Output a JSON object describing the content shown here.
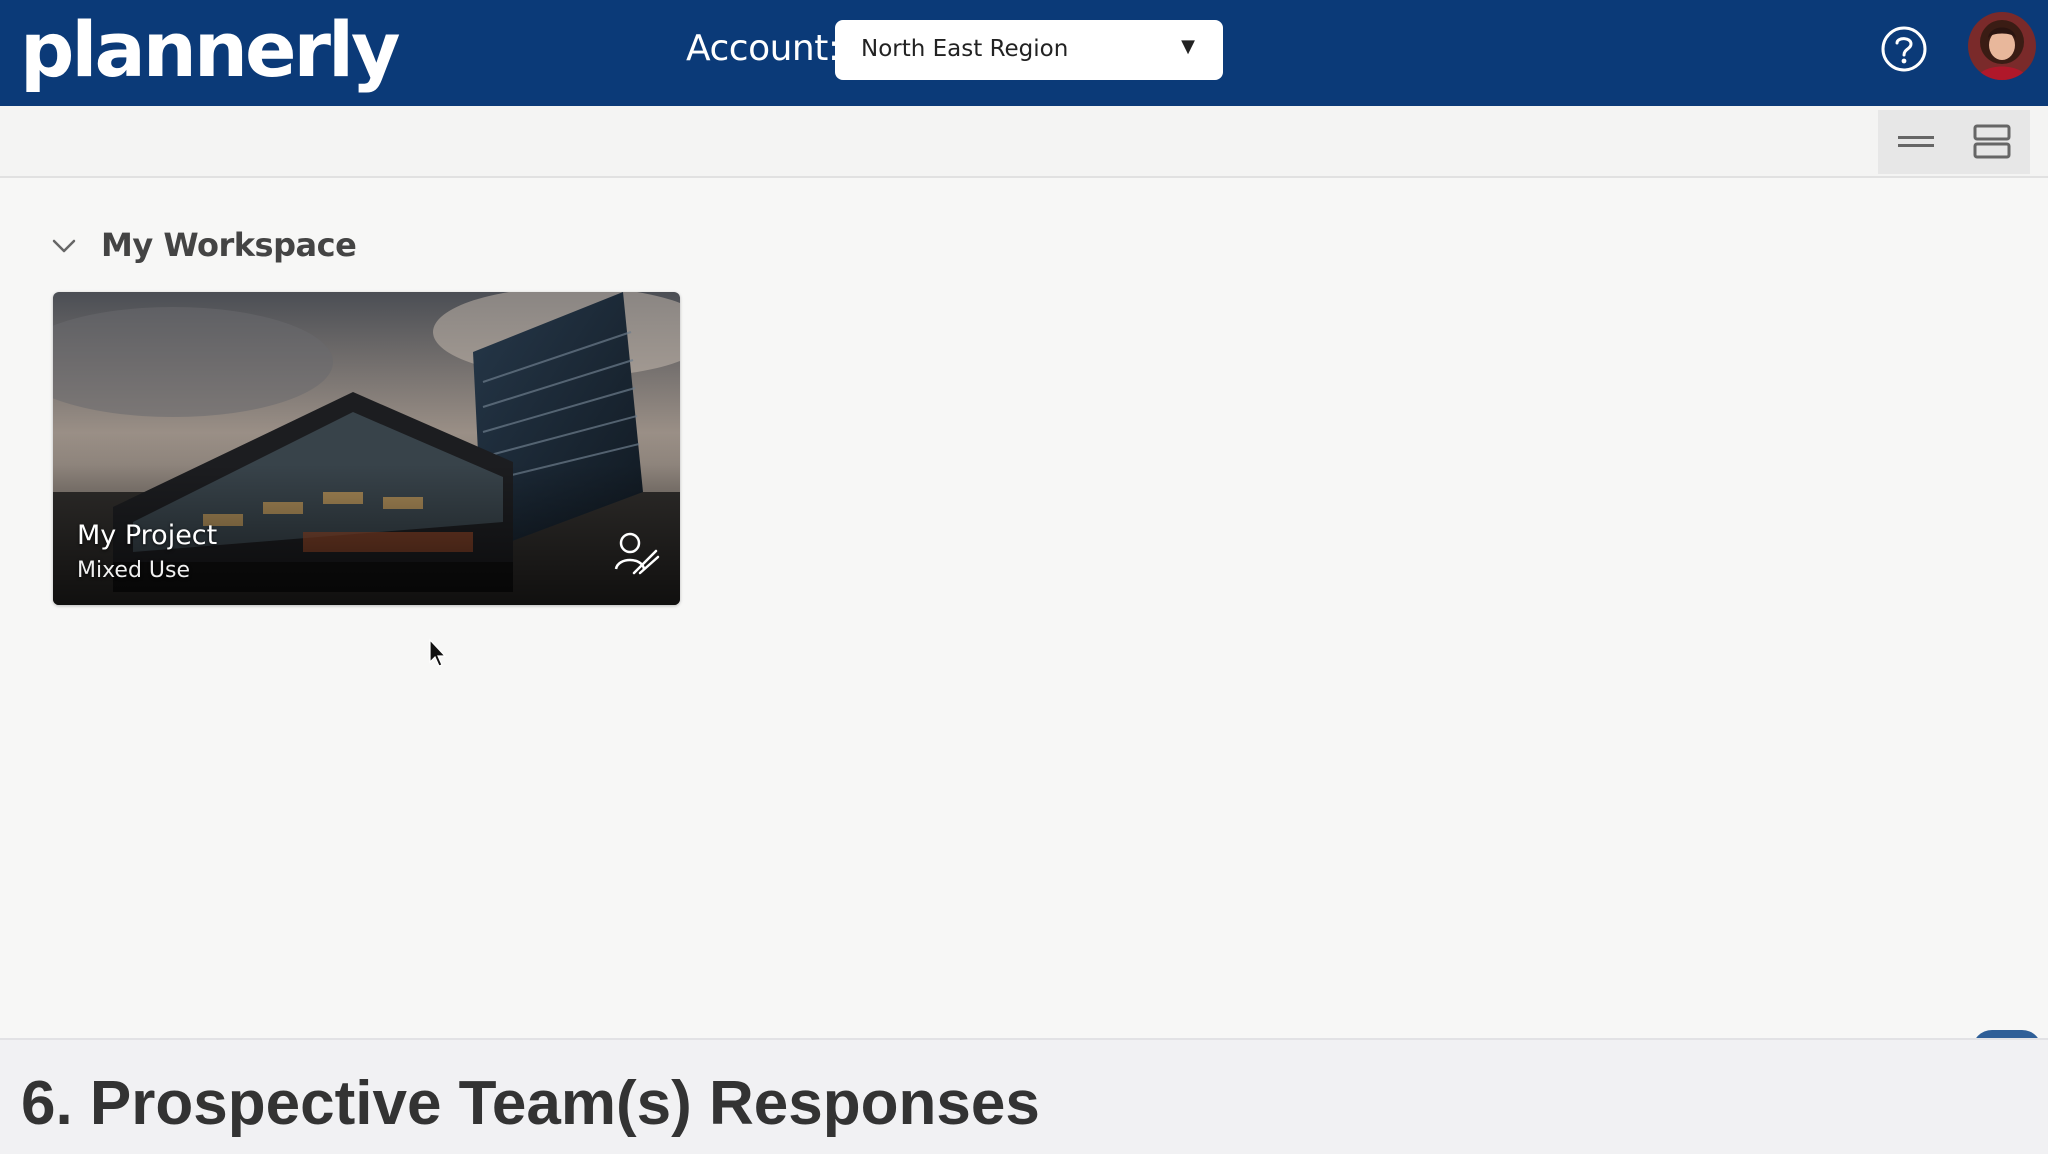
{
  "app": {
    "logo_text": "plannerly"
  },
  "header": {
    "account_label": "Account:",
    "account_value": "North East Region",
    "help_icon": "help-circle-icon",
    "avatar_icon": "user-avatar"
  },
  "toolbar": {
    "view_list_icon": "list-view-icon",
    "view_rows_icon": "rows-view-icon"
  },
  "workspace": {
    "title": "My Workspace",
    "projects": [
      {
        "title": "My Project",
        "subtitle": "Mixed Use",
        "icon": "team-icon"
      }
    ]
  },
  "caption": {
    "text": "6. Prospective Team(s) Responses"
  },
  "colors": {
    "header_bg": "#0b3a78",
    "page_bg": "#f7f7f6",
    "caption_bg": "#f1f1f3"
  }
}
